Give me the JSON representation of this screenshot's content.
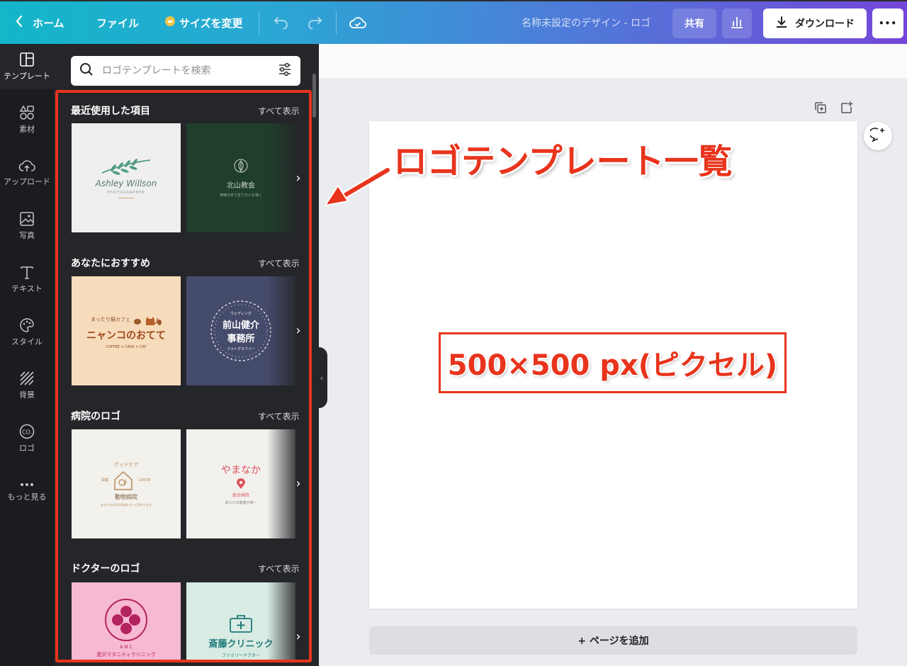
{
  "topbar": {
    "home": "ホーム",
    "file": "ファイル",
    "resize": "サイズを変更",
    "design_title": "名称未設定のデザイン - ロゴ",
    "share": "共有",
    "download": "ダウンロード",
    "more": "•••",
    "icons": [
      "chevron-left-icon",
      "crown-icon",
      "undo-icon",
      "redo-icon",
      "cloud-check-icon",
      "bar-chart-icon",
      "download-icon"
    ]
  },
  "rail": {
    "items": [
      {
        "label": "テンプレート",
        "icon": "template-icon",
        "active": true
      },
      {
        "label": "素材",
        "icon": "elements-icon"
      },
      {
        "label": "アップロード",
        "icon": "upload-cloud-icon"
      },
      {
        "label": "写真",
        "icon": "photo-icon"
      },
      {
        "label": "テキスト",
        "icon": "text-icon"
      },
      {
        "label": "スタイル",
        "icon": "palette-icon"
      },
      {
        "label": "背景",
        "icon": "background-icon"
      },
      {
        "label": "ロゴ",
        "icon": "logo-icon"
      },
      {
        "label": "もっと見る",
        "icon": "more-dots-icon"
      }
    ]
  },
  "panel": {
    "search_placeholder": "ロゴテンプレートを検索",
    "see_all": "すべて表示",
    "sections": [
      {
        "title": "最近使用した項目",
        "thumbs": [
          {
            "line1": "Ashley Willson",
            "line2": "PHOTOGRAPHER",
            "bg": "#efefef",
            "fg": "#6b8f7a"
          },
          {
            "line1": "北山教会",
            "line2": "神様の手で全ての人を導く",
            "bg": "#1f3e2c",
            "fg": "#cfd8cf"
          }
        ]
      },
      {
        "title": "あなたにおすすめ",
        "thumbs": [
          {
            "line0": "まったり猫カフェ",
            "line1": "ニャンコのおてて",
            "line2": "COFFEE × CAKE × CAT",
            "bg": "#f7dcbc",
            "fg": "#8a4a22"
          },
          {
            "line0": "ウェディング",
            "line1": "前山健介",
            "line1b": "事務所",
            "line2": "フォトグラファー",
            "bg": "#454b6b",
            "fg": "#ffffff"
          }
        ]
      },
      {
        "title": "病院のロゴ",
        "thumbs": [
          {
            "line0": "グッドケア",
            "year_left": "開業",
            "year_right": "1993年",
            "line1": "動物病院",
            "line2": "あなたの大切な家族をずっと見守ります",
            "bg": "#f2f1ec",
            "fg": "#b88a5a"
          },
          {
            "line1": "やまなか",
            "line1b": "総合病院",
            "line2": "あなたの健康が第一",
            "bg": "#f3f1ee",
            "fg": "#d9545b"
          }
        ]
      },
      {
        "title": "ドクターのロゴ",
        "thumbs": [
          {
            "line1": "A  M  C",
            "line2": "愛沢マタニティクリニック",
            "bg": "#f7b8d3",
            "fg": "#b4235d"
          },
          {
            "line1": "斎藤クリニック",
            "line2": "ファミリードクター",
            "bg": "#d8ece3",
            "fg": "#1f7a7a"
          }
        ]
      }
    ]
  },
  "canvas": {
    "add_page": "+ ページを追加"
  },
  "annotations": {
    "title": "ロゴテンプレート一覧",
    "size": "500×500 px(ピクセル)",
    "color": "#e8341c"
  }
}
